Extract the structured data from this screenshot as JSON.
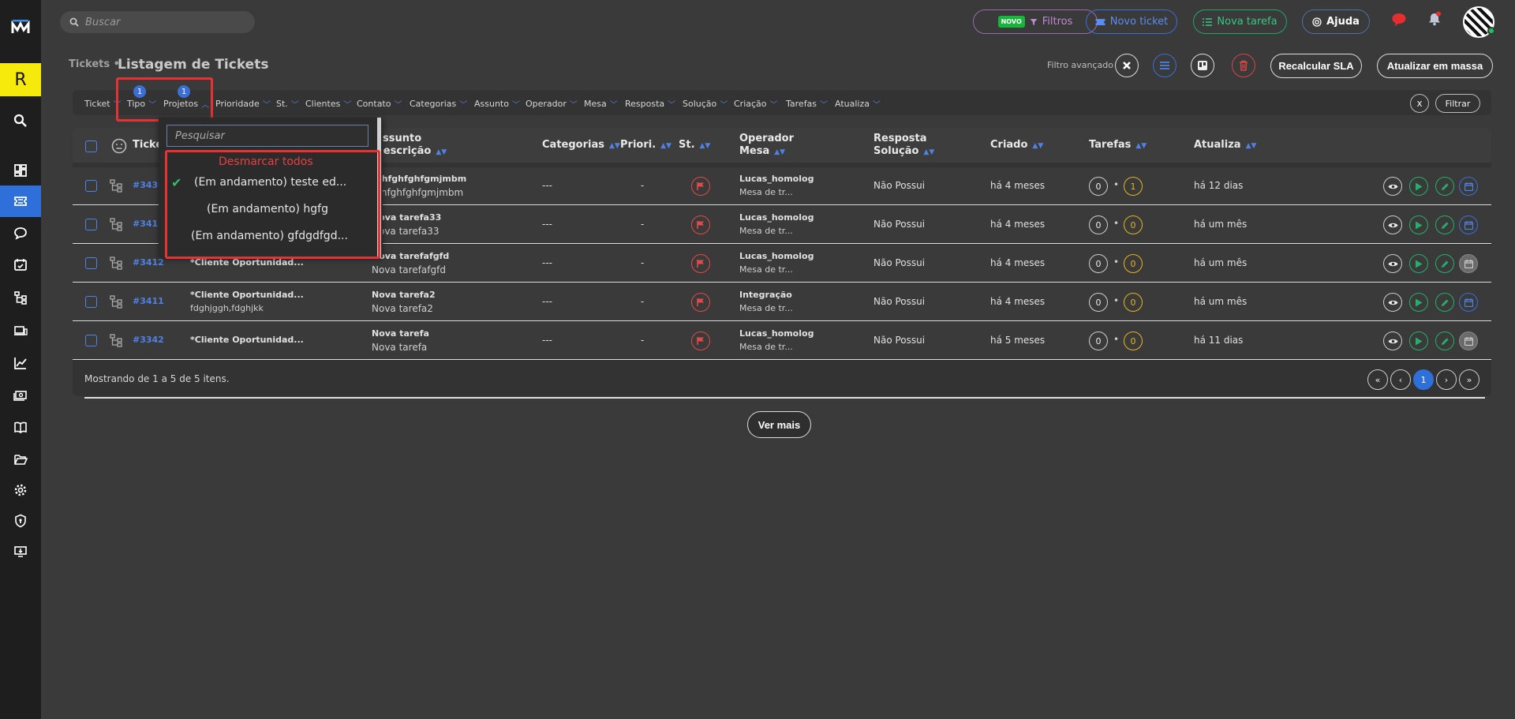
{
  "topbar": {
    "search_placeholder": "Buscar",
    "filters_badge": "NOVO",
    "filters_label": "Filtros",
    "new_ticket_label": "Novo ticket",
    "new_task_label": "Nova tarefa",
    "help_label": "Ajuda"
  },
  "sidebar": {
    "workspace_letter": "R"
  },
  "header": {
    "breadcrumb": "Tickets •",
    "title": "Listagem de Tickets",
    "advanced_filter_label": "Filtro avançado",
    "recalc_sla_label": "Recalcular SLA",
    "bulk_update_label": "Atualizar em massa"
  },
  "filterbar": {
    "items": [
      "Ticket",
      "Tipo",
      "Projetos",
      "Prioridade",
      "St.",
      "Clientes",
      "Contato",
      "Categorias",
      "Assunto",
      "Operador",
      "Mesa",
      "Resposta",
      "Solução",
      "Criação",
      "Tarefas",
      "Atualiza"
    ],
    "tipo_count": "1",
    "projetos_count": "1",
    "clear_label": "x",
    "filter_label": "Filtrar"
  },
  "dropdown": {
    "search_placeholder": "Pesquisar",
    "deselect_all": "Desmarcar todos",
    "options": [
      "(Em andamento) teste ed...",
      "(Em andamento) hgfg",
      "(Em andamento) gfdgdfgd..."
    ]
  },
  "table": {
    "headers": {
      "ticket": "Ticket",
      "assunto": "Assunto",
      "descricao": "Descrição",
      "categorias": "Categorias",
      "prioridade": "Priori.",
      "status": "St.",
      "operador": "Operador",
      "mesa": "Mesa",
      "resposta": "Resposta",
      "solucao": "Solução",
      "criado": "Criado",
      "tarefas": "Tarefas",
      "atualiza": "Atualiza"
    },
    "rows": [
      {
        "id": "#3430",
        "client": "",
        "client_sub": "",
        "subject": "gfhfghfghfgmjmbm",
        "desc": "gfhfghfghfgmjmbm",
        "categories": "---",
        "priority": "-",
        "operator": "Lucas_homolog",
        "mesa": "Mesa de tr...",
        "response": "Não Possui",
        "created": "há 4 meses",
        "tasks_a": "0",
        "tasks_b": "1",
        "updated": "há 12 dias",
        "cal_gray": false
      },
      {
        "id": "#3413",
        "client": "",
        "client_sub": "",
        "subject": "Nova tarefa33",
        "desc": "Nova tarefa33",
        "categories": "---",
        "priority": "-",
        "operator": "Lucas_homolog",
        "mesa": "Mesa de tr...",
        "response": "Não Possui",
        "created": "há 4 meses",
        "tasks_a": "0",
        "tasks_b": "0",
        "updated": "há um mês",
        "cal_gray": false
      },
      {
        "id": "#3412",
        "client": "*Cliente Oportunidad...",
        "client_sub": "",
        "subject": "Nova tarefafgfd",
        "desc": "Nova tarefafgfd",
        "categories": "---",
        "priority": "-",
        "operator": "Lucas_homolog",
        "mesa": "Mesa de tr...",
        "response": "Não Possui",
        "created": "há 4 meses",
        "tasks_a": "0",
        "tasks_b": "0",
        "updated": "há um mês",
        "cal_gray": true
      },
      {
        "id": "#3411",
        "client": "*Cliente Oportunidad...",
        "client_sub": "fdghjggh,fdghjkk",
        "subject": "Nova tarefa2",
        "desc": "Nova tarefa2",
        "categories": "---",
        "priority": "-",
        "operator": "Integração",
        "mesa": "Mesa de tr...",
        "response": "Não Possui",
        "created": "há 4 meses",
        "tasks_a": "0",
        "tasks_b": "0",
        "updated": "há um mês",
        "cal_gray": false
      },
      {
        "id": "#3342",
        "client": "*Cliente Oportunidad...",
        "client_sub": "",
        "subject": "Nova tarefa",
        "desc": "Nova tarefa",
        "categories": "---",
        "priority": "-",
        "operator": "Lucas_homolog",
        "mesa": "Mesa de tr...",
        "response": "Não Possui",
        "created": "há 5 meses",
        "tasks_a": "0",
        "tasks_b": "0",
        "updated": "há 11 dias",
        "cal_gray": true
      }
    ],
    "footer": "Mostrando de 1 a 5 de 5 itens.",
    "current_page": "1",
    "see_more": "Ver mais"
  },
  "colors": {
    "accent": "#2e6fd9",
    "success": "#25b06a",
    "danger": "#e53333",
    "warning": "#e6b422"
  }
}
